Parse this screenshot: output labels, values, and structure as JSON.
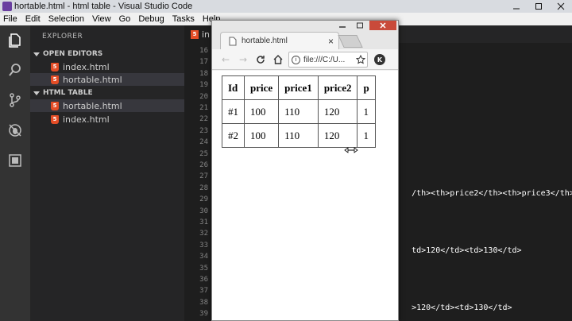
{
  "window": {
    "title": "hortable.html - html table - Visual Studio Code"
  },
  "menu": [
    "File",
    "Edit",
    "Selection",
    "View",
    "Go",
    "Debug",
    "Tasks",
    "Help"
  ],
  "sidebar": {
    "title": "EXPLORER",
    "open_editors": {
      "label": "OPEN EDITORS",
      "files": [
        "index.html",
        "hortable.html"
      ]
    },
    "project": {
      "label": "HTML TABLE",
      "files": [
        "hortable.html",
        "index.html"
      ]
    }
  },
  "editor": {
    "tab_label": "in",
    "line_numbers": [
      "16",
      "17",
      "18",
      "19",
      "20",
      "21",
      "22",
      "23",
      "24",
      "25",
      "26",
      "27",
      "28",
      "29",
      "30",
      "31",
      "32",
      "33",
      "34",
      "35",
      "36",
      "37",
      "38",
      "39"
    ],
    "visible_code": {
      "l28": "/th><th>price2</th><th>price3</th>",
      "l33": "td>120</td><td>130</td>",
      "l38": ">120</td><td>130</td>"
    }
  },
  "browser": {
    "tab_title": "hortable.html",
    "close_glyph": "×",
    "address": "file:///C:/U...",
    "profile_initial": "K",
    "table": {
      "headers": [
        "Id",
        "price",
        "price1",
        "price2",
        "p"
      ],
      "rows": [
        [
          "#1",
          "100",
          "110",
          "120",
          "1"
        ],
        [
          "#2",
          "100",
          "110",
          "120",
          "1"
        ]
      ]
    }
  },
  "icons": {
    "activity": [
      "files-icon",
      "search-icon",
      "source-control-icon",
      "debug-icon",
      "extensions-icon"
    ],
    "nav": [
      "back-icon",
      "forward-icon",
      "reload-icon",
      "home-icon"
    ]
  },
  "colors": {
    "activity_bar": "#333333",
    "sidebar": "#252526",
    "editor": "#1e1e1e",
    "html_icon": "#e44d26",
    "code_tag": "#569cd6"
  }
}
